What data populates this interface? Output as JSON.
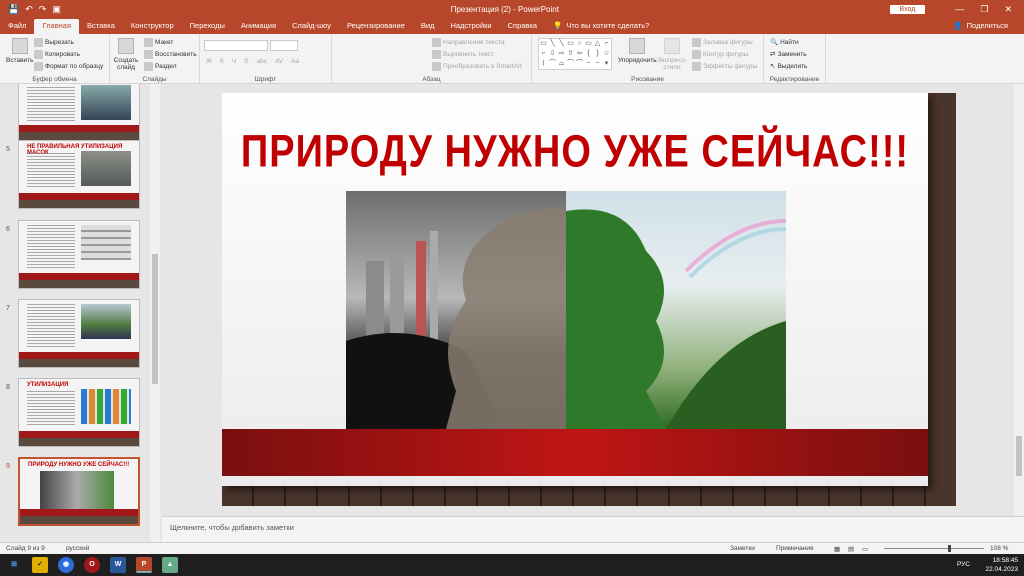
{
  "window": {
    "title": "Презентация (2)  -  PowerPoint",
    "signin": "Вход",
    "controls": [
      "—",
      "❐",
      "✕"
    ]
  },
  "qat": {
    "save": "💾",
    "undo": "↶",
    "redo": "↷",
    "present": "▣"
  },
  "menu": {
    "tabs": [
      "Файл",
      "Главная",
      "Вставка",
      "Конструктор",
      "Переходы",
      "Анимация",
      "Слайд-шоу",
      "Рецензирование",
      "Вид",
      "Надстройки",
      "Справка"
    ],
    "active": "Главная",
    "tellme": "Что вы хотите сделать?",
    "share": "Поделиться"
  },
  "ribbon": {
    "clipboard": {
      "paste": "Вставить",
      "cut": "Вырезать",
      "copy": "Копировать",
      "format": "Формат по образцу",
      "label": "Буфер обмена"
    },
    "slides": {
      "new": "Создать слайд",
      "layout": "Макет",
      "reset": "Восстановить",
      "section": "Раздел",
      "label": "Слайды"
    },
    "font": {
      "label": "Шрифт",
      "bold": "Ж",
      "italic": "К",
      "underline": "Ч",
      "strike": "S",
      "shadow": "abc",
      "spacing": "AV",
      "case": "Aa"
    },
    "paragraph": {
      "direction": "Направление текста",
      "align": "Выровнять текст",
      "smartart": "Преобразовать в SmartArt",
      "label": "Абзац"
    },
    "drawing": {
      "arrange": "Упорядочить",
      "styles": "Экспресс-стили",
      "fill": "Заливка фигуры",
      "outline": "Контур фигуры",
      "effects": "Эффекты фигуры",
      "label": "Рисование"
    },
    "editing": {
      "find": "Найти",
      "replace": "Заменить",
      "select": "Выделить",
      "label": "Редактирование"
    }
  },
  "thumbnails": [
    {
      "num": "",
      "title": ""
    },
    {
      "num": "5",
      "title": "НЕ ПРАВИЛЬНАЯ УТИЛИЗАЦИЯ МАСОК"
    },
    {
      "num": "6",
      "title": ""
    },
    {
      "num": "7",
      "title": ""
    },
    {
      "num": "8",
      "title": "УТИЛИЗАЦИЯ"
    },
    {
      "num": "9",
      "title": "ПРИРОДУ НУЖНО УЖЕ СЕЙЧАС!!!"
    }
  ],
  "slide": {
    "title": "ПРИРОДУ НУЖНО УЖЕ СЕЙЧАС!!!"
  },
  "notes": {
    "placeholder": "Щелкните, чтобы добавить заметки"
  },
  "status": {
    "slide": "Слайд 9 из 9",
    "lang": "русский",
    "notes": "Заметки",
    "comments": "Примечания",
    "zoom": "108 %"
  },
  "taskbar": {
    "lang": "РУС",
    "time": "18:58:45",
    "date": "22.04.2023"
  },
  "colors": {
    "accent": "#b7472a",
    "title_red": "#c00000"
  }
}
